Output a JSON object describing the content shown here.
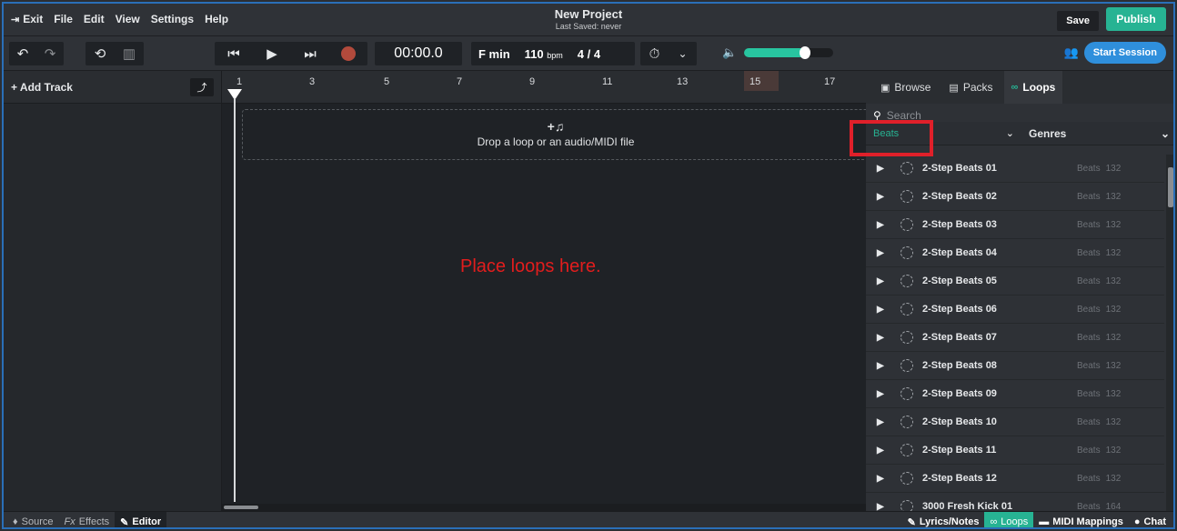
{
  "menu": {
    "exit": "Exit",
    "file": "File",
    "edit": "Edit",
    "view": "View",
    "settings": "Settings",
    "help": "Help"
  },
  "project": {
    "title": "New Project",
    "saved": "Last Saved: never"
  },
  "header_buttons": {
    "save": "Save",
    "publish": "Publish",
    "start_session": "Start Session"
  },
  "transport": {
    "time": "00:00.0",
    "key": "F min",
    "tempo": "110",
    "tempo_unit": "bpm",
    "signature": "4 / 4",
    "volume_level": 0.68
  },
  "tracks": {
    "add_track": "+ Add Track"
  },
  "ruler": {
    "numbers": [
      "1",
      "3",
      "5",
      "7",
      "9",
      "11",
      "13",
      "15",
      "17"
    ]
  },
  "dropzone": {
    "text": "Drop a loop or an audio/MIDI file"
  },
  "annotation": {
    "hint": "Place loops here."
  },
  "browser": {
    "tabs": {
      "browse": "Browse",
      "packs": "Packs",
      "loops": "Loops"
    },
    "search_placeholder": "Search",
    "filter_category": "Beats",
    "filter_genres": "Genres",
    "loops": [
      {
        "name": "2-Step Beats 01",
        "category": "Beats",
        "bpm": "132"
      },
      {
        "name": "2-Step Beats 02",
        "category": "Beats",
        "bpm": "132"
      },
      {
        "name": "2-Step Beats 03",
        "category": "Beats",
        "bpm": "132"
      },
      {
        "name": "2-Step Beats 04",
        "category": "Beats",
        "bpm": "132"
      },
      {
        "name": "2-Step Beats 05",
        "category": "Beats",
        "bpm": "132"
      },
      {
        "name": "2-Step Beats 06",
        "category": "Beats",
        "bpm": "132"
      },
      {
        "name": "2-Step Beats 07",
        "category": "Beats",
        "bpm": "132"
      },
      {
        "name": "2-Step Beats 08",
        "category": "Beats",
        "bpm": "132"
      },
      {
        "name": "2-Step Beats 09",
        "category": "Beats",
        "bpm": "132"
      },
      {
        "name": "2-Step Beats 10",
        "category": "Beats",
        "bpm": "132"
      },
      {
        "name": "2-Step Beats 11",
        "category": "Beats",
        "bpm": "132"
      },
      {
        "name": "2-Step Beats 12",
        "category": "Beats",
        "bpm": "132"
      },
      {
        "name": "3000 Fresh Kick 01",
        "category": "Beats",
        "bpm": "164"
      }
    ]
  },
  "bottom": {
    "source": "Source",
    "effects": "Effects",
    "editor": "Editor",
    "lyrics": "Lyrics/Notes",
    "loops": "Loops",
    "midi": "MIDI Mappings",
    "chat": "Chat"
  }
}
